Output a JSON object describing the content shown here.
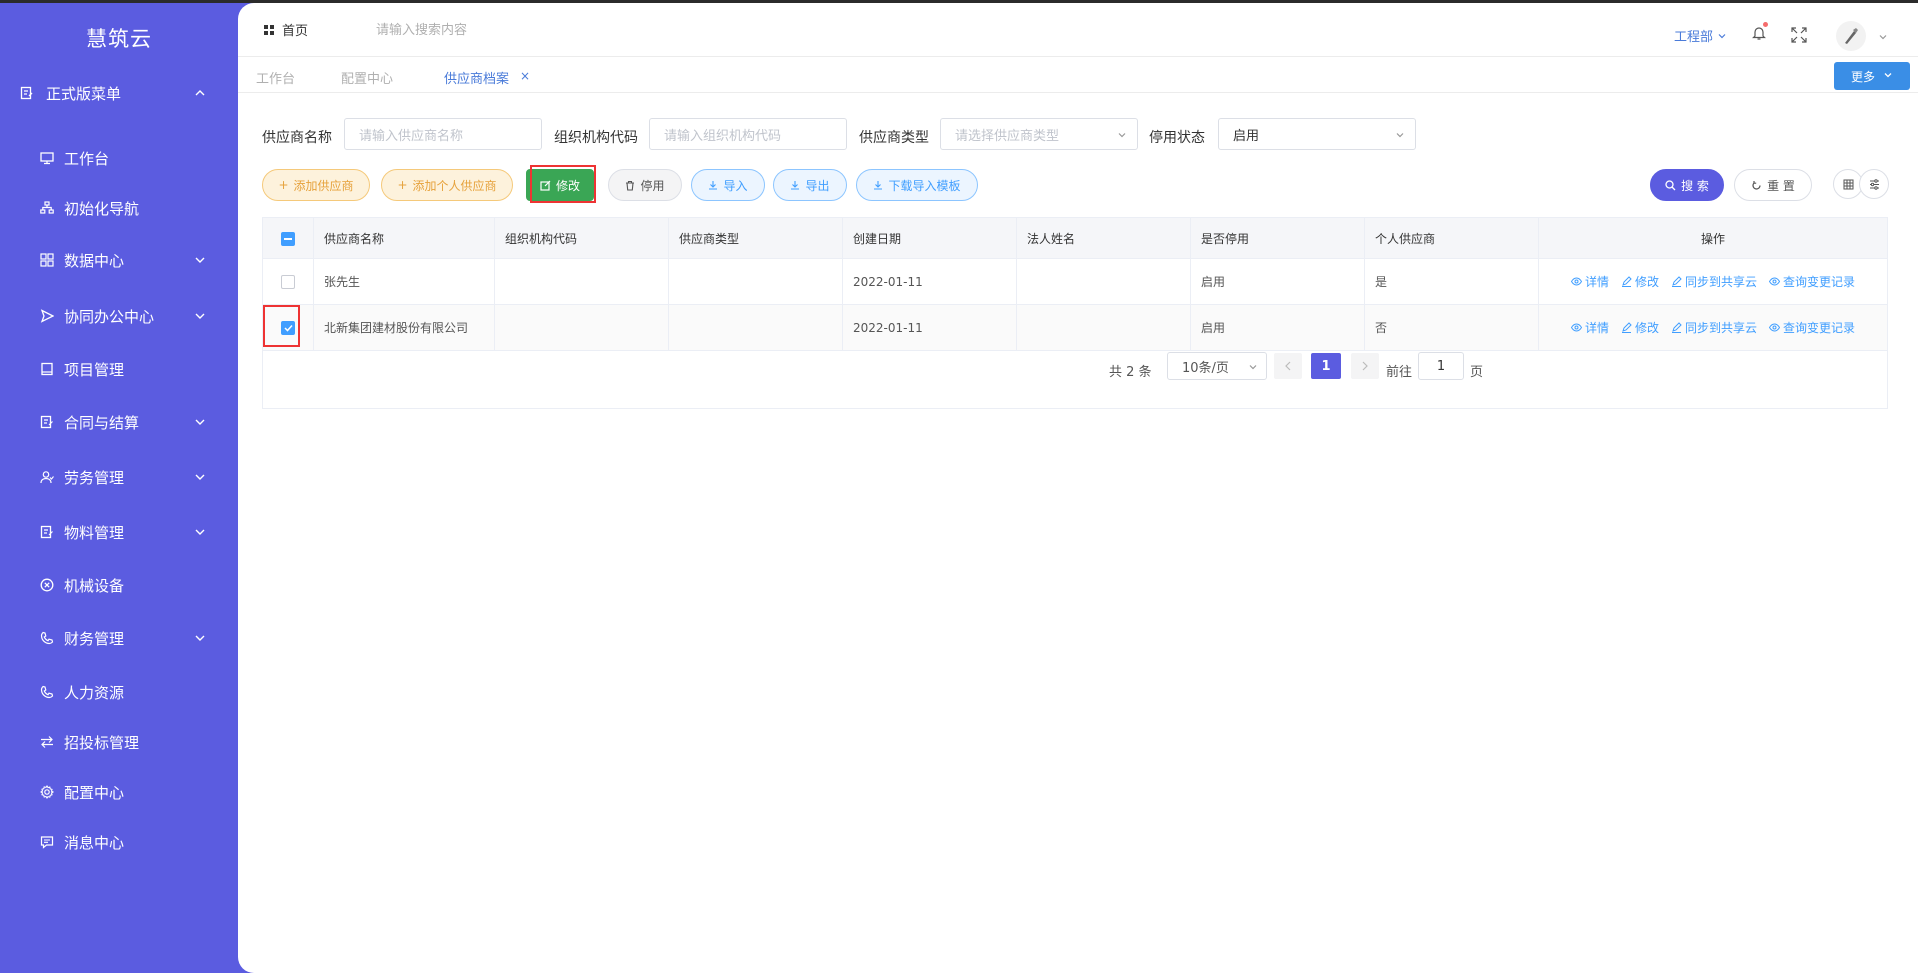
{
  "app": {
    "logo": "慧筑云"
  },
  "sidebar": {
    "section_title": "正式版菜单",
    "items": [
      {
        "label": "工作台",
        "icon": "monitor-icon",
        "expandable": false
      },
      {
        "label": "初始化导航",
        "icon": "sitemap-icon",
        "expandable": false
      },
      {
        "label": "数据中心",
        "icon": "grid-icon",
        "expandable": true
      },
      {
        "label": "协同办公中心",
        "icon": "send-icon",
        "expandable": true
      },
      {
        "label": "项目管理",
        "icon": "book-icon",
        "expandable": false
      },
      {
        "label": "合同与结算",
        "icon": "edit-doc-icon",
        "expandable": true
      },
      {
        "label": "劳务管理",
        "icon": "user-group-icon",
        "expandable": true
      },
      {
        "label": "物料管理",
        "icon": "edit-doc-icon",
        "expandable": true
      },
      {
        "label": "机械设备",
        "icon": "circle-x-icon",
        "expandable": false
      },
      {
        "label": "财务管理",
        "icon": "phone-icon",
        "expandable": true
      },
      {
        "label": "人力资源",
        "icon": "phone-icon",
        "expandable": false
      },
      {
        "label": "招投标管理",
        "icon": "swap-icon",
        "expandable": false
      },
      {
        "label": "配置中心",
        "icon": "gear-icon",
        "expandable": false
      },
      {
        "label": "消息中心",
        "icon": "message-icon",
        "expandable": false
      }
    ]
  },
  "header": {
    "home": "首页",
    "search_placeholder": "请输入搜索内容",
    "dept": "工程部"
  },
  "tabs": [
    {
      "label": "工作台",
      "active": false
    },
    {
      "label": "配置中心",
      "active": false
    },
    {
      "label": "供应商档案",
      "active": true
    }
  ],
  "more_button": "更多",
  "filters": {
    "name_label": "供应商名称",
    "name_placeholder": "请输入供应商名称",
    "code_label": "组织机构代码",
    "code_placeholder": "请输入组织机构代码",
    "type_label": "供应商类型",
    "type_placeholder": "请选择供应商类型",
    "status_label": "停用状态",
    "status_value": "启用"
  },
  "toolbar": {
    "add_supplier": "添加供应商",
    "add_personal": "添加个人供应商",
    "edit": "修改",
    "disable": "停用",
    "import": "导入",
    "export": "导出",
    "download_template": "下载导入模板",
    "search": "搜 索",
    "reset": "重 置"
  },
  "table": {
    "columns": [
      "供应商名称",
      "组织机构代码",
      "供应商类型",
      "创建日期",
      "法人姓名",
      "是否停用",
      "个人供应商",
      "操作"
    ],
    "rows": [
      {
        "name": "张先生",
        "org_code": "",
        "type": "",
        "created": "2022-01-11",
        "legal": "",
        "status": "启用",
        "personal": "是",
        "checked": false
      },
      {
        "name": "北新集团建材股份有限公司",
        "org_code": "",
        "type": "",
        "created": "2022-01-11",
        "legal": "",
        "status": "启用",
        "personal": "否",
        "checked": true
      }
    ],
    "actions": [
      "详情",
      "修改",
      "同步到共享云",
      "查询变更记录"
    ]
  },
  "pagination": {
    "total": "共 2 条",
    "page_size": "10条/页",
    "current": "1",
    "goto_label": "前往",
    "goto_value": "1",
    "page_suffix": "页"
  },
  "colors": {
    "sidebar": "#5b5ce0",
    "accent_blue": "#409eff",
    "edit_green": "#3aa655",
    "warn_orange": "#e6a23c",
    "highlight_red": "#ee3333"
  }
}
